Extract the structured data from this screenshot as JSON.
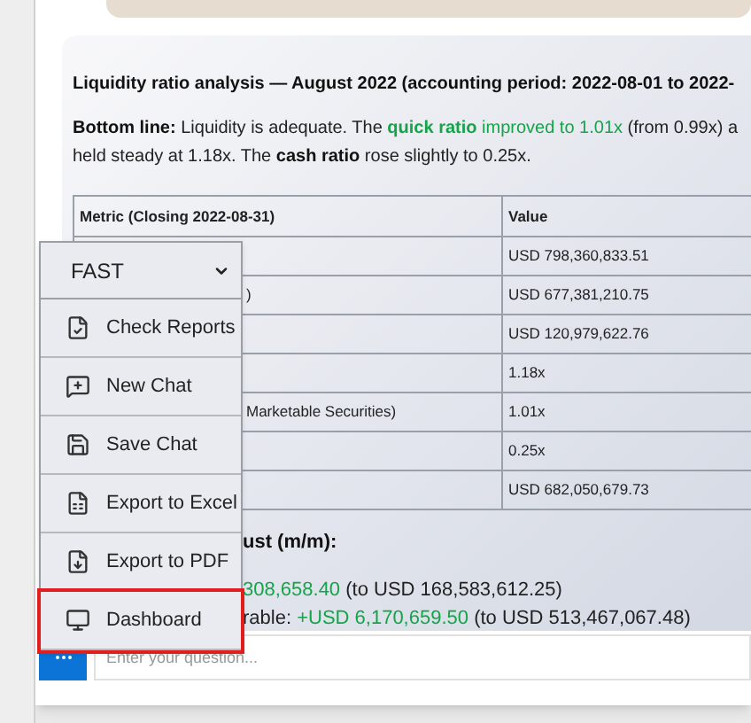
{
  "report": {
    "title": "Liquidity ratio analysis — August 2022 (accounting period: 2022-08-01 to 2022-",
    "summary": [
      {
        "text": "Bottom line:",
        "kind": "label"
      },
      {
        "text": " Liquidity is adequate. The ",
        "kind": "text"
      },
      {
        "text": "quick ratio",
        "kind": "key-positive"
      },
      {
        "text": " improved to 1.01x",
        "kind": "positive"
      },
      {
        "text": " (from 0.99x) a held steady at 1.18x. The ",
        "kind": "text"
      },
      {
        "text": "cash ratio",
        "kind": "label"
      },
      {
        "text": " rose slightly to 0.25x.",
        "kind": "text"
      }
    ],
    "table": {
      "columns": [
        "Metric (Closing 2022-08-31)",
        "Value"
      ],
      "rows": [
        {
          "metric": "",
          "value": "USD 798,360,833.51"
        },
        {
          "metric": ")",
          "value": "USD 677,381,210.75"
        },
        {
          "metric": "",
          "value": "USD 120,979,622.76"
        },
        {
          "metric": "",
          "value": "1.18x"
        },
        {
          "metric": "Marketable Securities)",
          "value": "1.01x"
        },
        {
          "metric": "",
          "value": "0.25x"
        },
        {
          "metric": "",
          "value": "USD 682,050,679.73"
        }
      ]
    },
    "section_heading": "ust (m/m):",
    "changes": [
      [
        {
          "text": "308,658.40",
          "kind": "positive"
        },
        {
          "text": " (to USD 168,583,612.25)",
          "kind": "text"
        }
      ],
      [
        {
          "text": "rable: ",
          "kind": "text"
        },
        {
          "text": "+USD 6,170,659.50",
          "kind": "positive"
        },
        {
          "text": " (to USD 513,467,067.48)",
          "kind": "text"
        }
      ]
    ]
  },
  "menu": {
    "mode": "FAST",
    "items": [
      {
        "label": "Check Reports",
        "kind": "check",
        "highlighted": false
      },
      {
        "label": "New Chat",
        "kind": "chat",
        "highlighted": false
      },
      {
        "label": "Save Chat",
        "kind": "save",
        "highlighted": false
      },
      {
        "label": "Export to Excel",
        "kind": "excel",
        "highlighted": false
      },
      {
        "label": "Export to PDF",
        "kind": "pdf",
        "highlighted": false
      },
      {
        "label": "Dashboard",
        "kind": "dashboard",
        "highlighted": true
      }
    ]
  },
  "input": {
    "placeholder": "Enter your question..."
  }
}
